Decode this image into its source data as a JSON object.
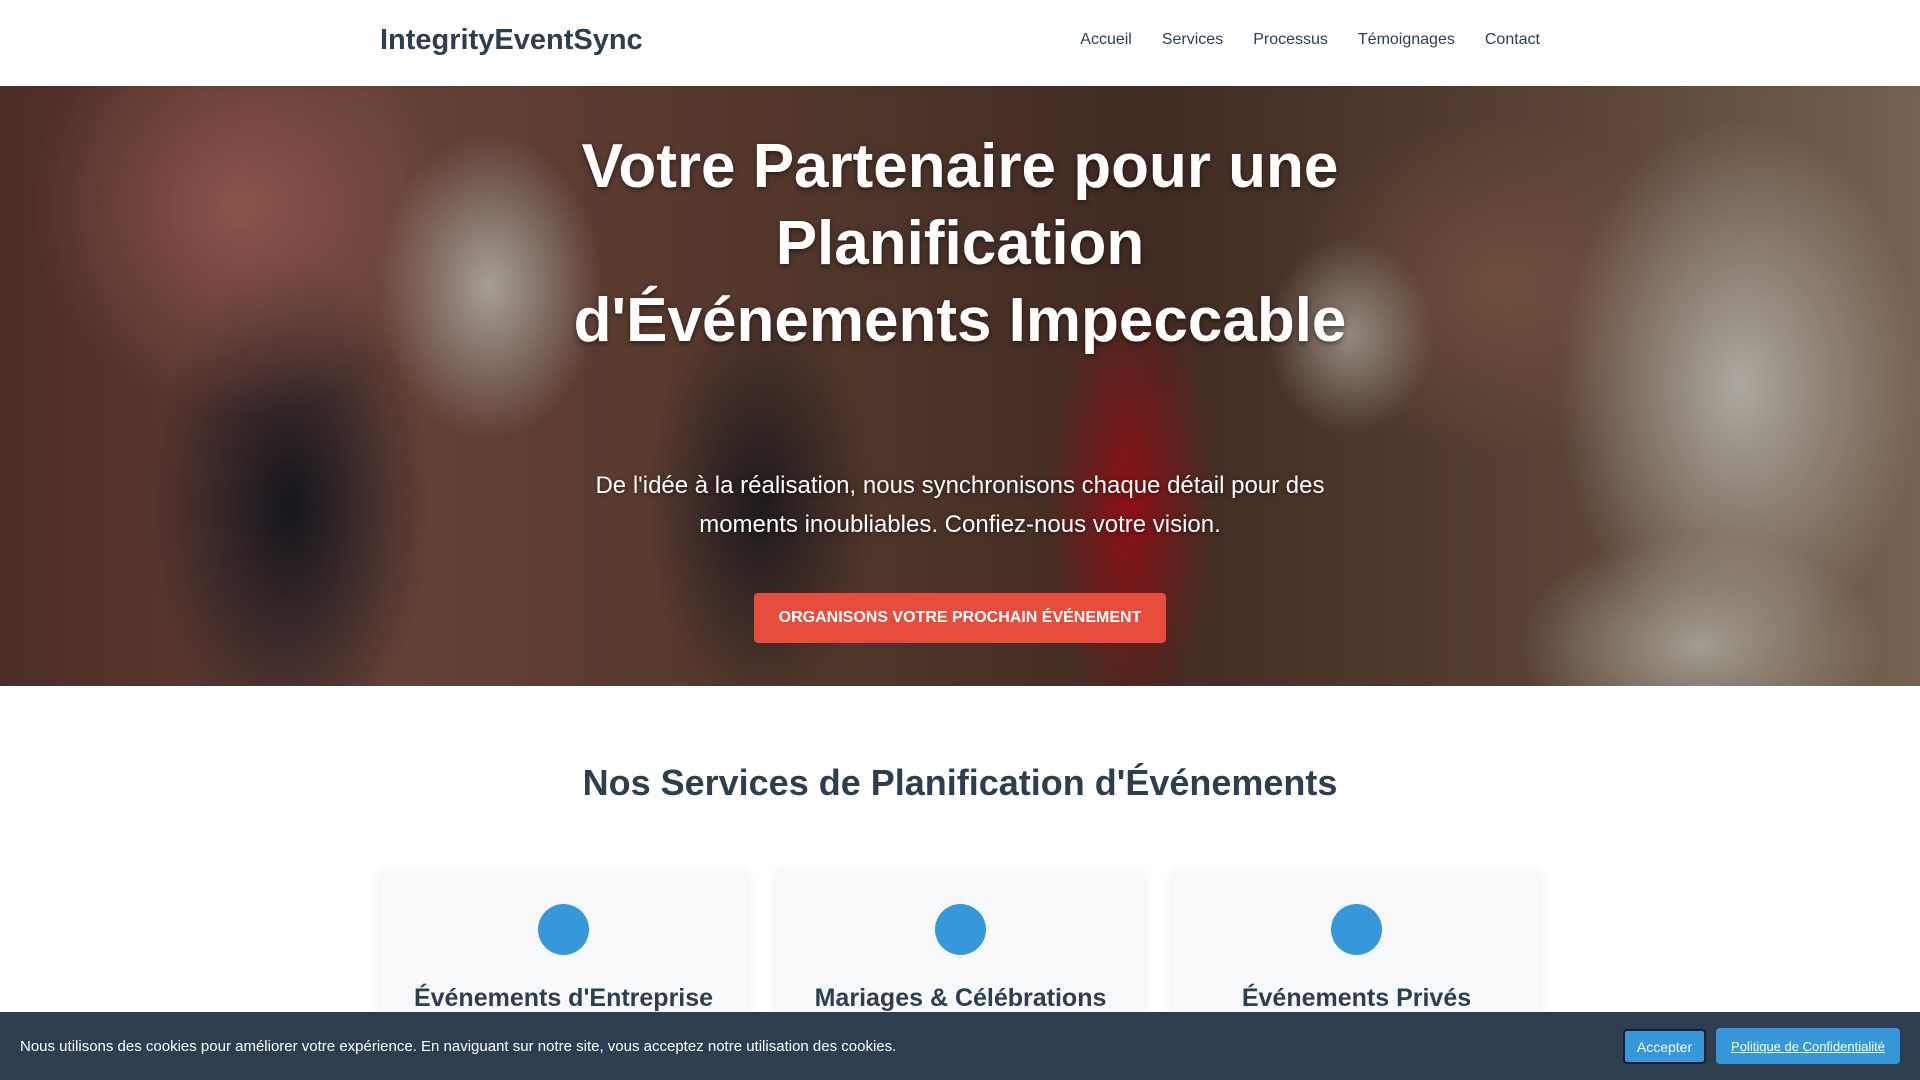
{
  "header": {
    "brand": "IntegrityEventSync",
    "nav": [
      "Accueil",
      "Services",
      "Processus",
      "Témoignages",
      "Contact"
    ]
  },
  "hero": {
    "title": "Votre Partenaire pour une Planification d'Événements Impeccable",
    "subtitle": "De l'idée à la réalisation, nous synchronisons chaque détail pour des moments inoubliables. Confiez-nous votre vision.",
    "cta_label": "Organisons votre prochain événement"
  },
  "services": {
    "title": "Nos Services de Planification d'Événements",
    "cards": [
      {
        "title": "Événements d'Entreprise"
      },
      {
        "title": "Mariages & Célébrations"
      },
      {
        "title": "Événements Privés"
      }
    ]
  },
  "cookie": {
    "message": "Nous utilisons des cookies pour améliorer votre expérience. En naviguant sur notre site, vous acceptez notre utilisation des cookies.",
    "accept_label": "Accepter",
    "policy_label": "Politique de Confidentialité"
  },
  "colors": {
    "primary_text": "#2c3e50",
    "accent_red": "#e74c3c",
    "accent_blue": "#3498db",
    "banner_bg": "#2c3e50"
  }
}
